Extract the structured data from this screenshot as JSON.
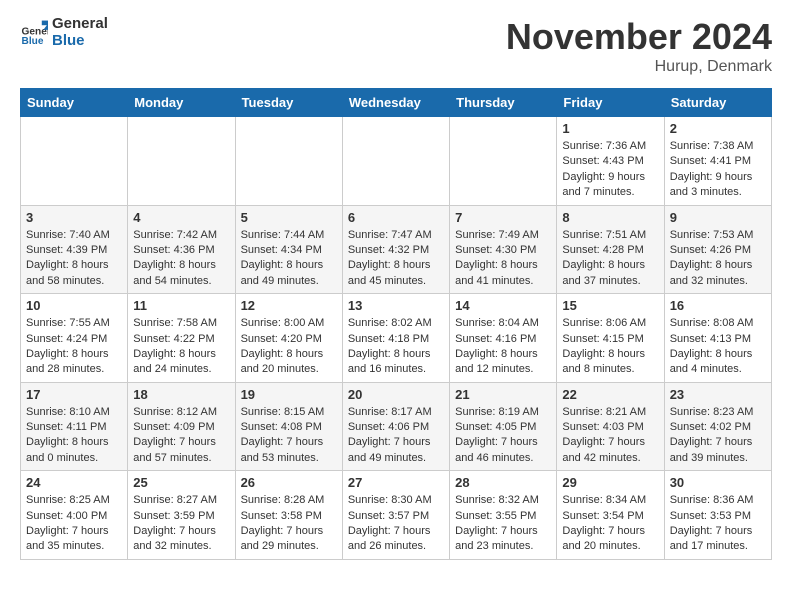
{
  "logo": {
    "text_general": "General",
    "text_blue": "Blue"
  },
  "header": {
    "month": "November 2024",
    "location": "Hurup, Denmark"
  },
  "weekdays": [
    "Sunday",
    "Monday",
    "Tuesday",
    "Wednesday",
    "Thursday",
    "Friday",
    "Saturday"
  ],
  "weeks": [
    [
      {
        "day": "",
        "info": ""
      },
      {
        "day": "",
        "info": ""
      },
      {
        "day": "",
        "info": ""
      },
      {
        "day": "",
        "info": ""
      },
      {
        "day": "",
        "info": ""
      },
      {
        "day": "1",
        "info": "Sunrise: 7:36 AM\nSunset: 4:43 PM\nDaylight: 9 hours\nand 7 minutes."
      },
      {
        "day": "2",
        "info": "Sunrise: 7:38 AM\nSunset: 4:41 PM\nDaylight: 9 hours\nand 3 minutes."
      }
    ],
    [
      {
        "day": "3",
        "info": "Sunrise: 7:40 AM\nSunset: 4:39 PM\nDaylight: 8 hours\nand 58 minutes."
      },
      {
        "day": "4",
        "info": "Sunrise: 7:42 AM\nSunset: 4:36 PM\nDaylight: 8 hours\nand 54 minutes."
      },
      {
        "day": "5",
        "info": "Sunrise: 7:44 AM\nSunset: 4:34 PM\nDaylight: 8 hours\nand 49 minutes."
      },
      {
        "day": "6",
        "info": "Sunrise: 7:47 AM\nSunset: 4:32 PM\nDaylight: 8 hours\nand 45 minutes."
      },
      {
        "day": "7",
        "info": "Sunrise: 7:49 AM\nSunset: 4:30 PM\nDaylight: 8 hours\nand 41 minutes."
      },
      {
        "day": "8",
        "info": "Sunrise: 7:51 AM\nSunset: 4:28 PM\nDaylight: 8 hours\nand 37 minutes."
      },
      {
        "day": "9",
        "info": "Sunrise: 7:53 AM\nSunset: 4:26 PM\nDaylight: 8 hours\nand 32 minutes."
      }
    ],
    [
      {
        "day": "10",
        "info": "Sunrise: 7:55 AM\nSunset: 4:24 PM\nDaylight: 8 hours\nand 28 minutes."
      },
      {
        "day": "11",
        "info": "Sunrise: 7:58 AM\nSunset: 4:22 PM\nDaylight: 8 hours\nand 24 minutes."
      },
      {
        "day": "12",
        "info": "Sunrise: 8:00 AM\nSunset: 4:20 PM\nDaylight: 8 hours\nand 20 minutes."
      },
      {
        "day": "13",
        "info": "Sunrise: 8:02 AM\nSunset: 4:18 PM\nDaylight: 8 hours\nand 16 minutes."
      },
      {
        "day": "14",
        "info": "Sunrise: 8:04 AM\nSunset: 4:16 PM\nDaylight: 8 hours\nand 12 minutes."
      },
      {
        "day": "15",
        "info": "Sunrise: 8:06 AM\nSunset: 4:15 PM\nDaylight: 8 hours\nand 8 minutes."
      },
      {
        "day": "16",
        "info": "Sunrise: 8:08 AM\nSunset: 4:13 PM\nDaylight: 8 hours\nand 4 minutes."
      }
    ],
    [
      {
        "day": "17",
        "info": "Sunrise: 8:10 AM\nSunset: 4:11 PM\nDaylight: 8 hours\nand 0 minutes."
      },
      {
        "day": "18",
        "info": "Sunrise: 8:12 AM\nSunset: 4:09 PM\nDaylight: 7 hours\nand 57 minutes."
      },
      {
        "day": "19",
        "info": "Sunrise: 8:15 AM\nSunset: 4:08 PM\nDaylight: 7 hours\nand 53 minutes."
      },
      {
        "day": "20",
        "info": "Sunrise: 8:17 AM\nSunset: 4:06 PM\nDaylight: 7 hours\nand 49 minutes."
      },
      {
        "day": "21",
        "info": "Sunrise: 8:19 AM\nSunset: 4:05 PM\nDaylight: 7 hours\nand 46 minutes."
      },
      {
        "day": "22",
        "info": "Sunrise: 8:21 AM\nSunset: 4:03 PM\nDaylight: 7 hours\nand 42 minutes."
      },
      {
        "day": "23",
        "info": "Sunrise: 8:23 AM\nSunset: 4:02 PM\nDaylight: 7 hours\nand 39 minutes."
      }
    ],
    [
      {
        "day": "24",
        "info": "Sunrise: 8:25 AM\nSunset: 4:00 PM\nDaylight: 7 hours\nand 35 minutes."
      },
      {
        "day": "25",
        "info": "Sunrise: 8:27 AM\nSunset: 3:59 PM\nDaylight: 7 hours\nand 32 minutes."
      },
      {
        "day": "26",
        "info": "Sunrise: 8:28 AM\nSunset: 3:58 PM\nDaylight: 7 hours\nand 29 minutes."
      },
      {
        "day": "27",
        "info": "Sunrise: 8:30 AM\nSunset: 3:57 PM\nDaylight: 7 hours\nand 26 minutes."
      },
      {
        "day": "28",
        "info": "Sunrise: 8:32 AM\nSunset: 3:55 PM\nDaylight: 7 hours\nand 23 minutes."
      },
      {
        "day": "29",
        "info": "Sunrise: 8:34 AM\nSunset: 3:54 PM\nDaylight: 7 hours\nand 20 minutes."
      },
      {
        "day": "30",
        "info": "Sunrise: 8:36 AM\nSunset: 3:53 PM\nDaylight: 7 hours\nand 17 minutes."
      }
    ]
  ]
}
